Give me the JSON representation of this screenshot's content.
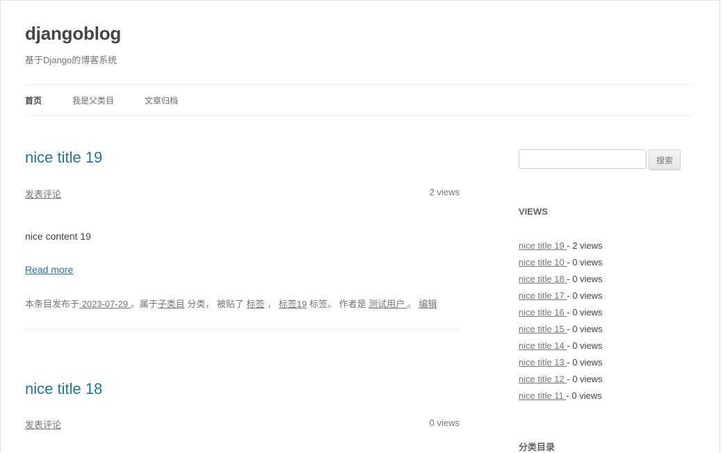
{
  "site": {
    "title": "djangoblog",
    "description": "基于Django的博客系统"
  },
  "nav": {
    "items": [
      {
        "label": "首页"
      },
      {
        "label": "我是父类目"
      },
      {
        "label": "文章归档"
      }
    ]
  },
  "posts": [
    {
      "title": "nice title 19",
      "comment_label": "发表评论",
      "views": "2 views",
      "content": "nice content 19",
      "read_more": "Read more",
      "meta": {
        "prefix": "本条目发布于",
        "date": " 2023-07-29 ",
        "belongs": "。属于",
        "category": "子类目",
        "category_suffix": " 分类， 被贴了 ",
        "tag1": "标签",
        "tag_sep": " ， ",
        "tag2": "标签19",
        "tag_suffix": " 标签。 作者是 ",
        "author": "测试用户 ",
        "author_suffix": "。 ",
        "edit": "编辑"
      }
    },
    {
      "title": "nice title 18",
      "comment_label": "发表评论",
      "views": "0 views"
    }
  ],
  "sidebar": {
    "search_button": "搜索",
    "search_value": "",
    "views_title": "VIEWS",
    "views_items": [
      {
        "title": "nice title 19 ",
        "count": "- 2 views"
      },
      {
        "title": "nice title 10 ",
        "count": "- 0 views"
      },
      {
        "title": "nice title 18 ",
        "count": "- 0 views"
      },
      {
        "title": "nice title 17 ",
        "count": "- 0 views"
      },
      {
        "title": "nice title 16 ",
        "count": "- 0 views"
      },
      {
        "title": "nice title 15 ",
        "count": "- 0 views"
      },
      {
        "title": "nice title 14 ",
        "count": "- 0 views"
      },
      {
        "title": "nice title 13 ",
        "count": "- 0 views"
      },
      {
        "title": "nice title 12 ",
        "count": "- 0 views"
      },
      {
        "title": "nice title 11 ",
        "count": "- 0 views"
      }
    ],
    "category_title": "分类目录"
  }
}
